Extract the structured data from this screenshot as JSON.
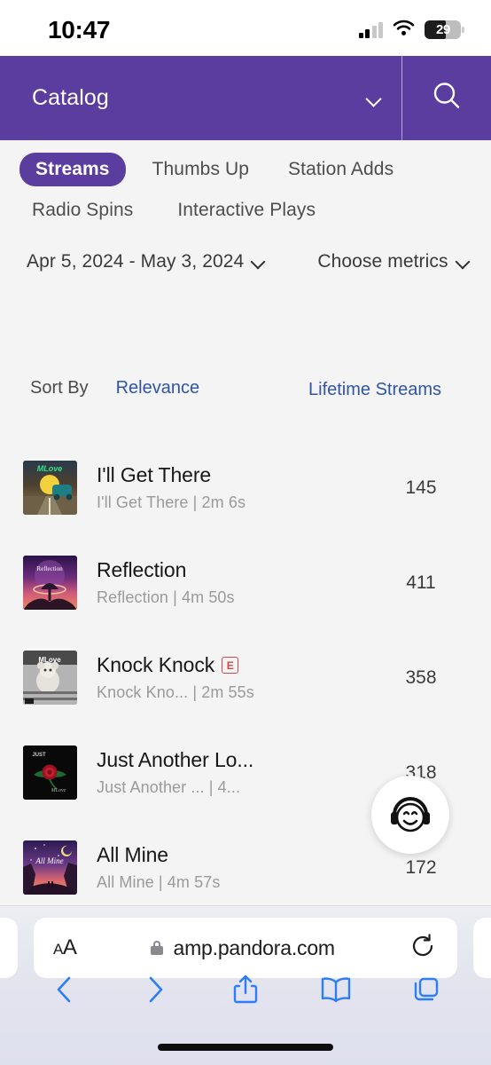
{
  "status_bar": {
    "time": "10:47",
    "signal_icon": "cellular-signal-icon",
    "wifi_icon": "wifi-icon",
    "battery_icon": "battery-icon",
    "battery_level": "29"
  },
  "app_header": {
    "title": "Catalog",
    "dropdown_icon": "chevron-down-icon",
    "search_icon": "search-icon",
    "background_color": "#5b3d9f"
  },
  "tabs": {
    "row1": [
      {
        "label": "Streams",
        "active": true
      },
      {
        "label": "Thumbs Up",
        "active": false
      },
      {
        "label": "Station Adds",
        "active": false
      }
    ],
    "row2": [
      {
        "label": "Radio Spins",
        "active": false
      },
      {
        "label": "Interactive Plays",
        "active": false
      }
    ]
  },
  "filters": {
    "date_range": "Apr 5, 2024 - May 3, 2024",
    "date_range_icon": "chevron-down-icon",
    "metrics": "Choose metrics",
    "metrics_icon": "chevron-down-icon"
  },
  "sort": {
    "label": "Sort By",
    "value": "Relevance",
    "metric_column": "Lifetime Streams",
    "link_color": "#2f55a4"
  },
  "tracks": [
    {
      "title": "I'll Get There",
      "explicit": false,
      "subtitle": "I'll Get There | 2m 6s",
      "count": "145",
      "art_name": "album-art-ill-get-there"
    },
    {
      "title": "Reflection",
      "explicit": false,
      "subtitle": "Reflection | 4m 50s",
      "count": "411",
      "art_name": "album-art-reflection"
    },
    {
      "title": "Knock Knock",
      "explicit": true,
      "explicit_label": "E",
      "subtitle": "Knock Kno... | 2m 55s",
      "count": "358",
      "art_name": "album-art-knock-knock"
    },
    {
      "title": "Just Another Lo...",
      "explicit": false,
      "subtitle": "Just Another ... | 4...",
      "count": "318",
      "art_name": "album-art-just-another-love-song"
    },
    {
      "title": "All Mine",
      "explicit": false,
      "subtitle": "All Mine | 4m 57s",
      "count": "172",
      "art_name": "album-art-all-mine"
    }
  ],
  "chat_widget": {
    "icon": "headphones-smiley-icon"
  },
  "browser": {
    "text_size_label": "AA",
    "lock_icon": "lock-icon",
    "url": "amp.pandora.com",
    "reload_icon": "reload-icon",
    "back_icon": "back-chevron-icon",
    "forward_icon": "forward-chevron-icon",
    "share_icon": "share-icon",
    "bookmarks_icon": "book-icon",
    "tabs_icon": "tabs-icon",
    "accent_color": "#2d7df6"
  }
}
